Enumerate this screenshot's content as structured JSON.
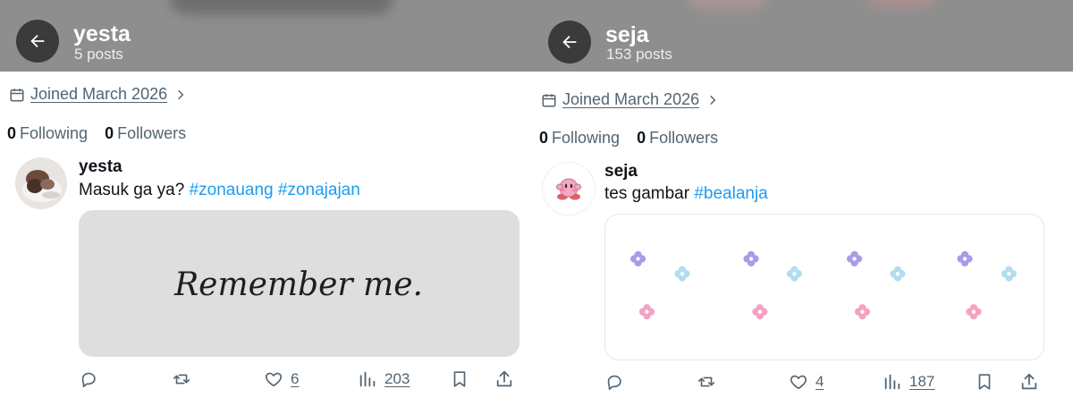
{
  "left": {
    "header": {
      "name": "yesta",
      "post_count": "5 posts"
    },
    "joined": "Joined March 2026",
    "following_count": "0",
    "following_label": "Following",
    "followers_count": "0",
    "followers_label": "Followers",
    "post": {
      "author": "yesta",
      "text": "Masuk ga ya?",
      "hashtags": [
        "#zonauang",
        "#zonajajan"
      ],
      "image_text": "Remember me.",
      "likes": "6",
      "views": "203"
    }
  },
  "right": {
    "header": {
      "name": "seja",
      "post_count": "153 posts"
    },
    "joined": "Joined March 2026",
    "following_count": "0",
    "following_label": "Following",
    "followers_count": "0",
    "followers_label": "Followers",
    "post": {
      "author": "seja",
      "text": "tes gambar",
      "hashtags": [
        "#bealanja"
      ],
      "likes": "4",
      "views": "187"
    }
  },
  "colors": {
    "header_bg": "#8e8e8e",
    "back_button": "#3b3b3b",
    "hashtag": "#1d9bf0",
    "secondary_text": "#536471",
    "flower_purple": "#a99be8",
    "flower_blue": "#b4dcf0",
    "flower_pink": "#f3a2c2"
  },
  "icons": [
    "back-arrow-icon",
    "calendar-icon",
    "chevron-right-icon",
    "reply-icon",
    "retweet-icon",
    "like-icon",
    "views-icon",
    "bookmark-icon",
    "share-icon",
    "kirby-avatar-icon",
    "flower-icon"
  ]
}
